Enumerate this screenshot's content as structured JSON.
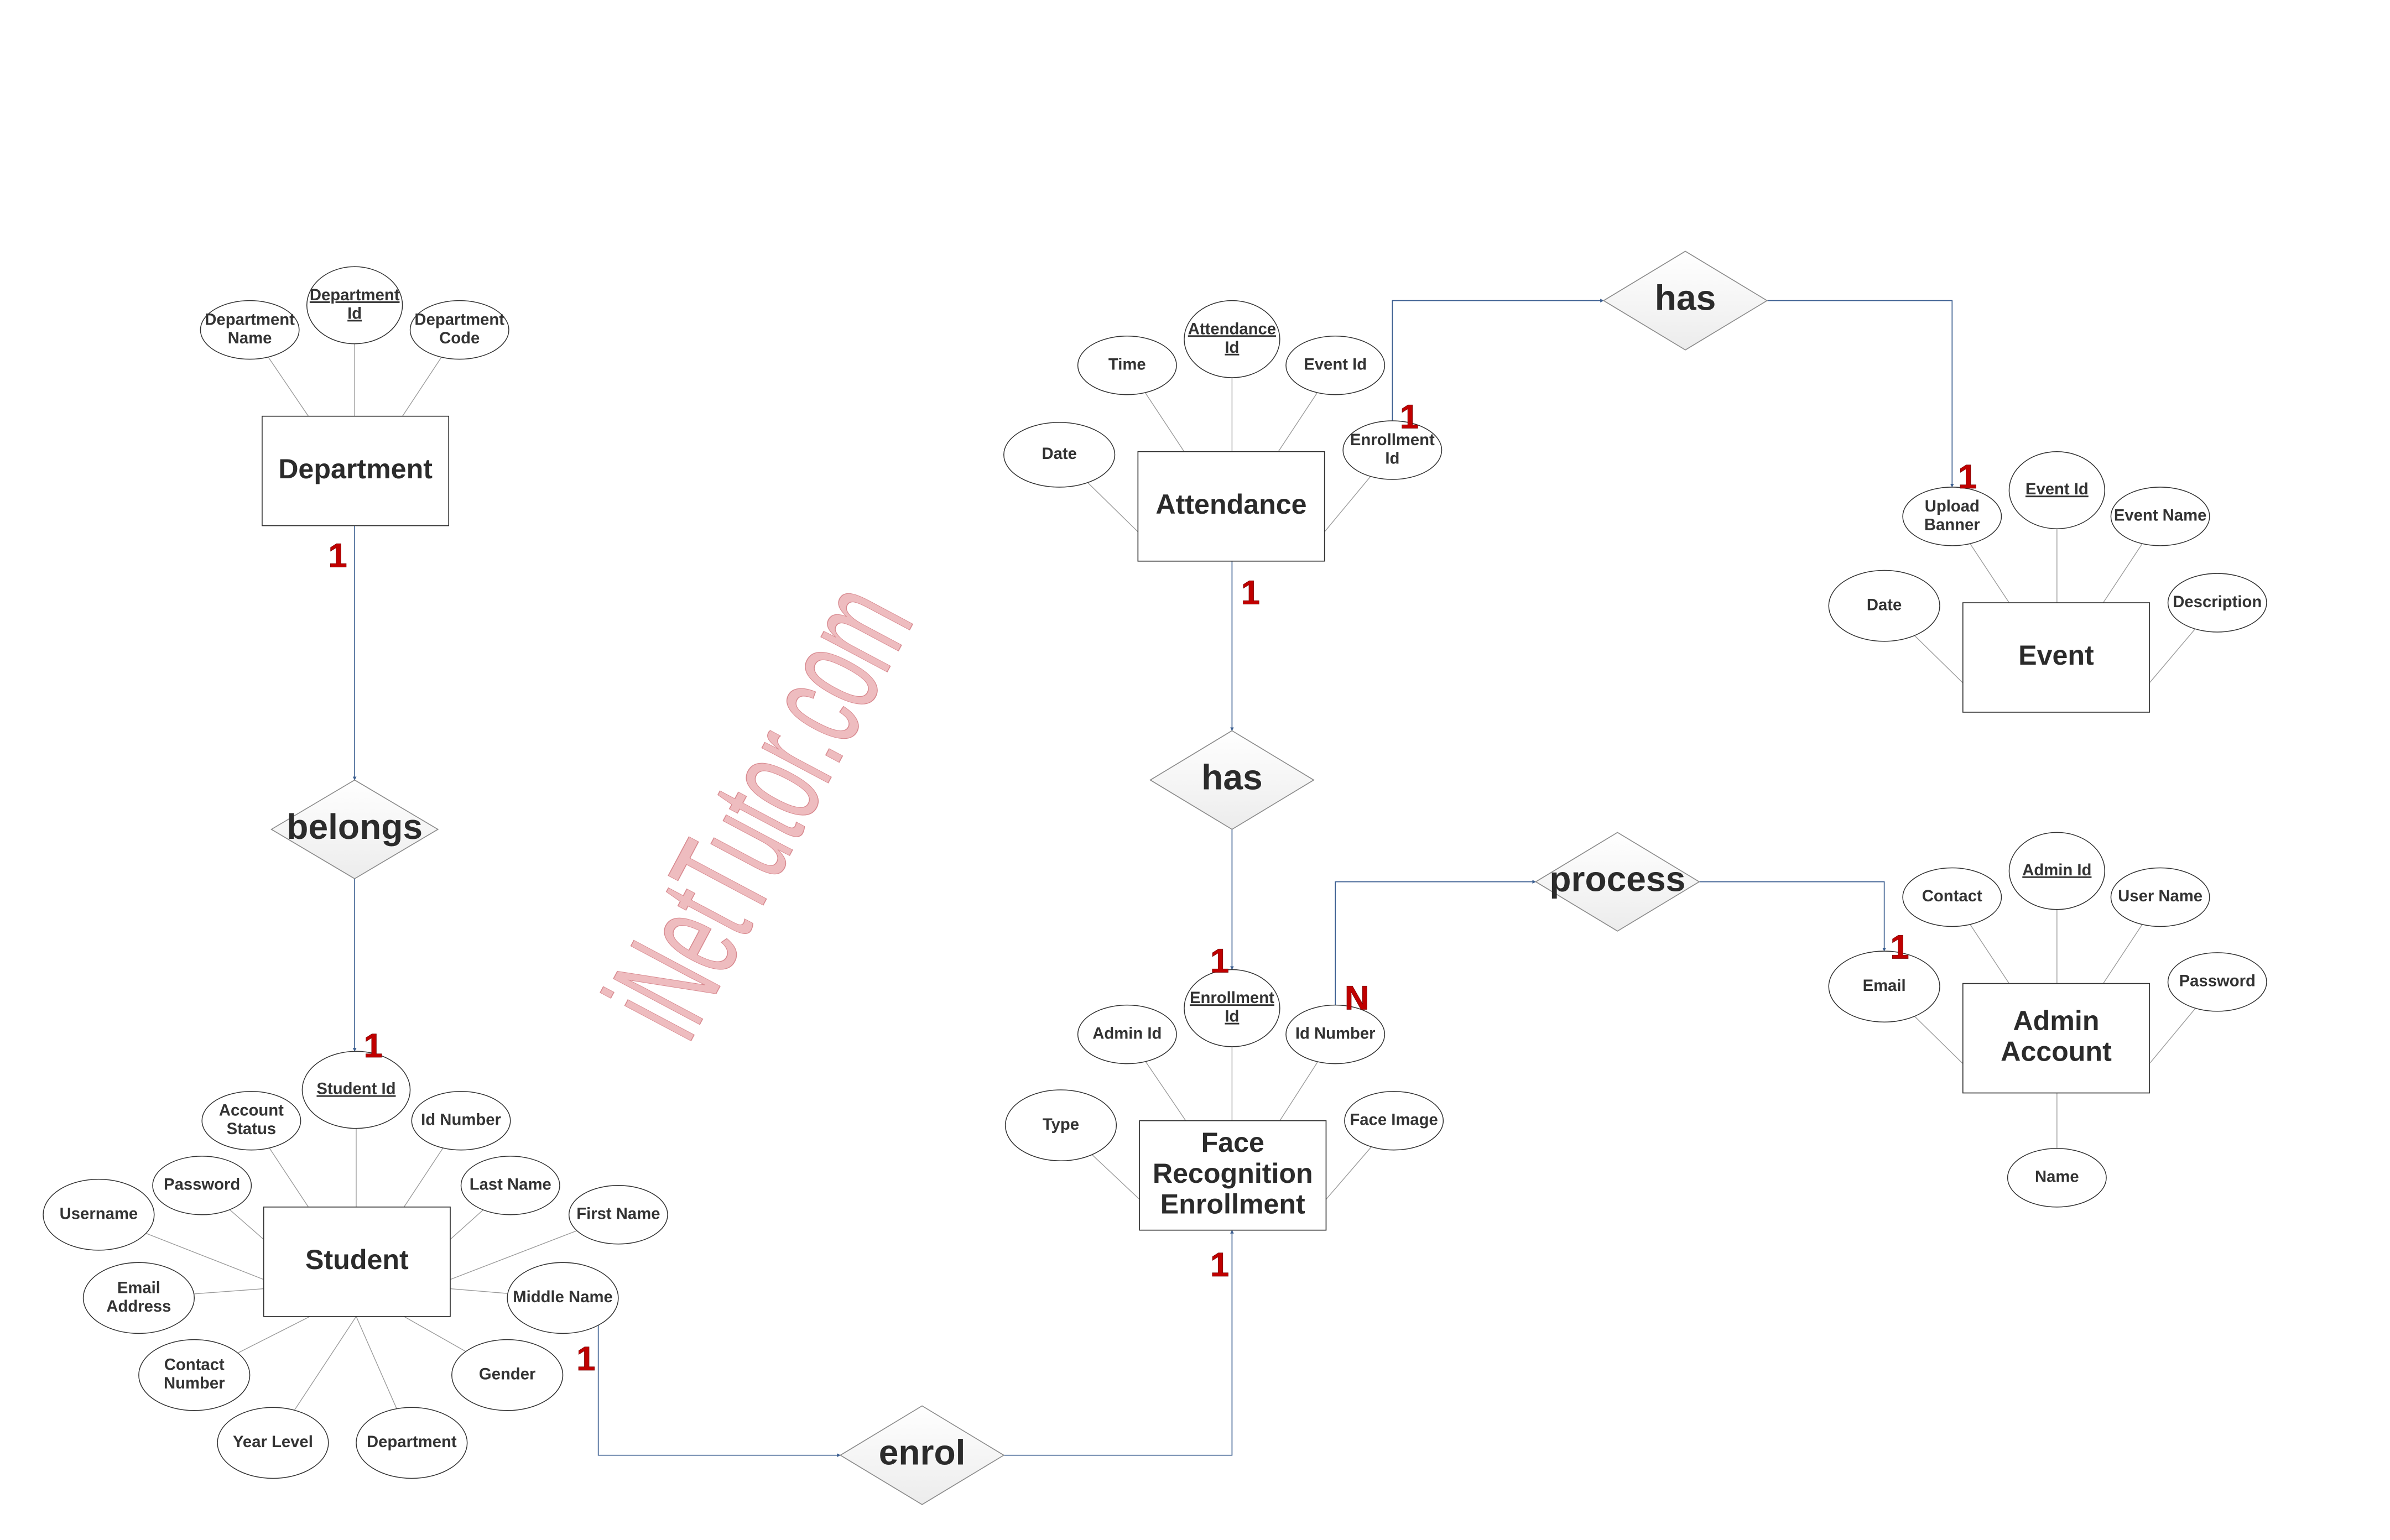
{
  "watermark": "iNetTutor.com",
  "colors": {
    "connector": "#3c5f91",
    "cardinality": "#c00000",
    "watermark": "#eebcbf",
    "text": "#333333"
  },
  "entities": [
    {
      "id": "department",
      "label": [
        "Department"
      ],
      "attributes": [
        {
          "label": [
            "Department",
            "Name"
          ],
          "key": false
        },
        {
          "label": [
            "Department",
            "Id"
          ],
          "key": true
        },
        {
          "label": [
            "Department",
            "Code"
          ],
          "key": false
        }
      ]
    },
    {
      "id": "student",
      "label": [
        "Student"
      ],
      "attributes": [
        {
          "label": [
            "Student Id"
          ],
          "key": true
        },
        {
          "label": [
            "Account",
            "Status"
          ],
          "key": false
        },
        {
          "label": [
            "Id Number"
          ],
          "key": false
        },
        {
          "label": [
            "Password"
          ],
          "key": false
        },
        {
          "label": [
            "Last Name"
          ],
          "key": false
        },
        {
          "label": [
            "Username"
          ],
          "key": false
        },
        {
          "label": [
            "First Name"
          ],
          "key": false
        },
        {
          "label": [
            "Email",
            "Address"
          ],
          "key": false
        },
        {
          "label": [
            "Middle Name"
          ],
          "key": false
        },
        {
          "label": [
            "Contact",
            "Number"
          ],
          "key": false
        },
        {
          "label": [
            "Gender"
          ],
          "key": false
        },
        {
          "label": [
            "Year Level"
          ],
          "key": false
        },
        {
          "label": [
            "Department"
          ],
          "key": false
        }
      ]
    },
    {
      "id": "attendance",
      "label": [
        "Attendance"
      ],
      "attributes": [
        {
          "label": [
            "Attendance",
            "Id"
          ],
          "key": true
        },
        {
          "label": [
            "Time"
          ],
          "key": false
        },
        {
          "label": [
            "Event Id"
          ],
          "key": false
        },
        {
          "label": [
            "Date"
          ],
          "key": false
        },
        {
          "label": [
            "Enrollment",
            "Id"
          ],
          "key": false
        }
      ]
    },
    {
      "id": "event",
      "label": [
        "Event"
      ],
      "attributes": [
        {
          "label": [
            "Event Id"
          ],
          "key": true
        },
        {
          "label": [
            "Upload",
            "Banner"
          ],
          "key": false
        },
        {
          "label": [
            "Event Name"
          ],
          "key": false
        },
        {
          "label": [
            "Date"
          ],
          "key": false
        },
        {
          "label": [
            "Description"
          ],
          "key": false
        }
      ]
    },
    {
      "id": "face-recognition-enrollment",
      "label": [
        "Face",
        "Recognition",
        "Enrollment"
      ],
      "attributes": [
        {
          "label": [
            "Enrollment",
            "Id"
          ],
          "key": true
        },
        {
          "label": [
            "Admin Id"
          ],
          "key": false
        },
        {
          "label": [
            "Id Number"
          ],
          "key": false
        },
        {
          "label": [
            "Type"
          ],
          "key": false
        },
        {
          "label": [
            "Face Image"
          ],
          "key": false
        }
      ]
    },
    {
      "id": "admin-account",
      "label": [
        "Admin",
        "Account"
      ],
      "attributes": [
        {
          "label": [
            "Admin Id"
          ],
          "key": true
        },
        {
          "label": [
            "Contact"
          ],
          "key": false
        },
        {
          "label": [
            "User Name"
          ],
          "key": false
        },
        {
          "label": [
            "Email"
          ],
          "key": false
        },
        {
          "label": [
            "Password"
          ],
          "key": false
        },
        {
          "label": [
            "Name"
          ],
          "key": false
        }
      ]
    }
  ],
  "relationships": [
    {
      "id": "belongs",
      "label": "belongs",
      "from": "Department",
      "to": "Student",
      "cardinality": [
        "1",
        "1"
      ]
    },
    {
      "id": "has-attendance-enrollment",
      "label": "has",
      "from": "Attendance",
      "to": "Face Recognition Enrollment",
      "cardinality": [
        "1",
        "1"
      ]
    },
    {
      "id": "has-attendance-event",
      "label": "has",
      "from": "Attendance",
      "to": "Event",
      "cardinality": [
        "1",
        "1"
      ]
    },
    {
      "id": "process",
      "label": "process",
      "from": "Face Recognition Enrollment",
      "to": "Admin Account",
      "cardinality": [
        "N",
        "1"
      ]
    },
    {
      "id": "enrol",
      "label": "enrol",
      "from": "Student",
      "to": "Face Recognition Enrollment",
      "cardinality": [
        "1",
        "1"
      ]
    }
  ]
}
